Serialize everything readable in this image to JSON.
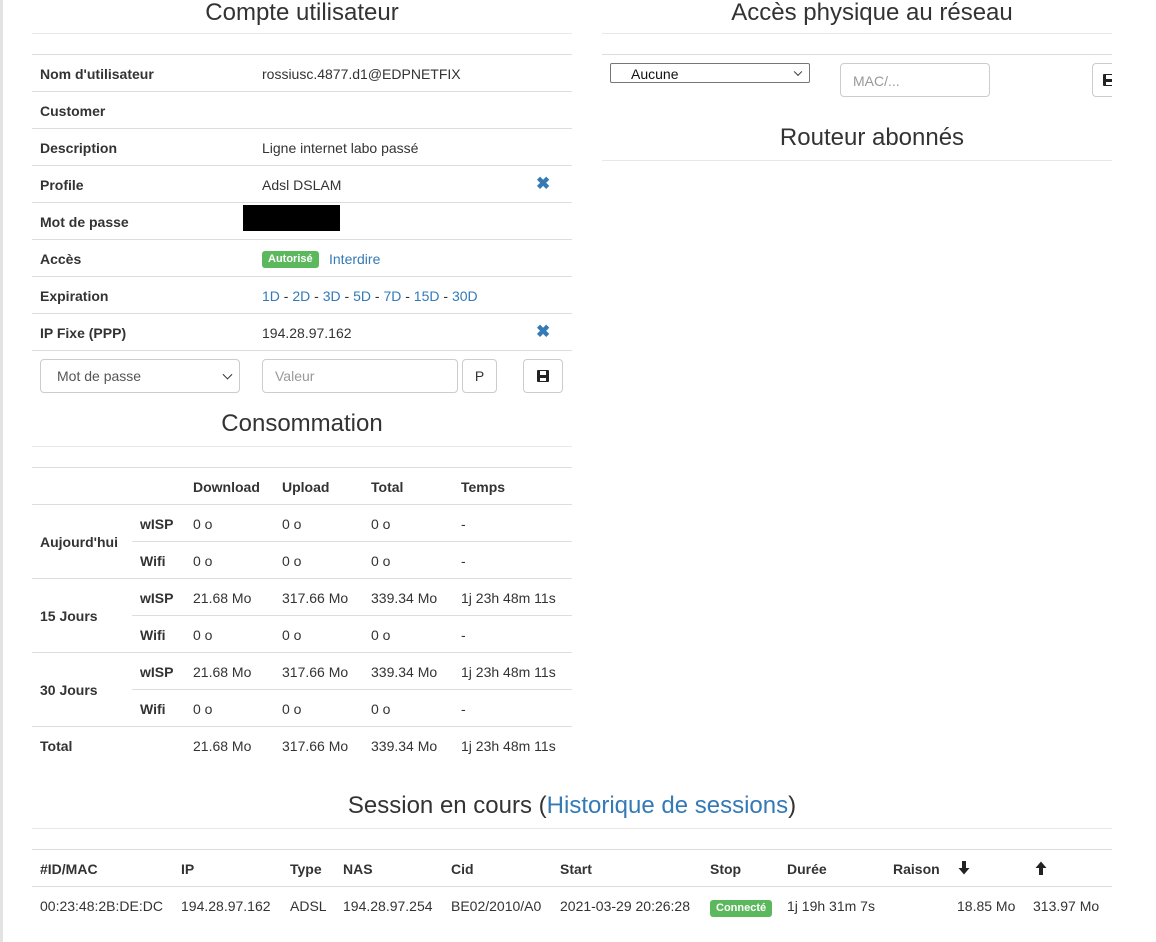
{
  "account": {
    "title": "Compte utilisateur",
    "rows": [
      {
        "label": "Nom d'utilisateur",
        "value": "rossiusc.4877.d1@EDPNETFIX"
      },
      {
        "label": "Customer",
        "value": ""
      },
      {
        "label": "Description",
        "value": "Ligne internet labo passé"
      },
      {
        "label": "Profile",
        "value": "Adsl DSLAM"
      },
      {
        "label": "Mot de passe",
        "value": ""
      },
      {
        "label": "Accès",
        "status_badge": "Autorisé",
        "action_link": "Interdire"
      },
      {
        "label": "Expiration",
        "options": [
          "1D",
          "2D",
          "3D",
          "5D",
          "7D",
          "15D",
          "30D"
        ],
        "separator": " - "
      },
      {
        "label": "IP Fixe (PPP)",
        "value": "194.28.97.162"
      }
    ],
    "form": {
      "select_value": "Mot de passe",
      "input_placeholder": "Valeur",
      "p_button": "P"
    }
  },
  "network": {
    "title": "Accès physique au réseau",
    "select_value": "Aucune",
    "mac_placeholder": "MAC/..."
  },
  "router": {
    "title": "Routeur abonnés"
  },
  "consumption": {
    "title": "Consommation",
    "headers": [
      "Download",
      "Upload",
      "Total",
      "Temps"
    ],
    "groups": [
      {
        "period": "Aujourd'hui",
        "rows": [
          {
            "type": "wISP",
            "download": "0 o",
            "upload": "0 o",
            "total": "0 o",
            "time": "-"
          },
          {
            "type": "Wifi",
            "download": "0 o",
            "upload": "0 o",
            "total": "0 o",
            "time": "-"
          }
        ]
      },
      {
        "period": "15 Jours",
        "rows": [
          {
            "type": "wISP",
            "download": "21.68 Mo",
            "upload": "317.66 Mo",
            "total": "339.34 Mo",
            "time": "1j 23h 48m 11s"
          },
          {
            "type": "Wifi",
            "download": "0 o",
            "upload": "0 o",
            "total": "0 o",
            "time": "-"
          }
        ]
      },
      {
        "period": "30 Jours",
        "rows": [
          {
            "type": "wISP",
            "download": "21.68 Mo",
            "upload": "317.66 Mo",
            "total": "339.34 Mo",
            "time": "1j 23h 48m 11s"
          },
          {
            "type": "Wifi",
            "download": "0 o",
            "upload": "0 o",
            "total": "0 o",
            "time": "-"
          }
        ]
      }
    ],
    "total": {
      "label": "Total",
      "download": "21.68 Mo",
      "upload": "317.66 Mo",
      "total": "339.34 Mo",
      "time": "1j 23h 48m 11s"
    }
  },
  "session": {
    "title_prefix": "Session en cours (",
    "history_link": "Historique de sessions",
    "title_suffix": ")",
    "headers": {
      "id": "#ID/MAC",
      "ip": "IP",
      "type": "Type",
      "nas": "NAS",
      "cid": "Cid",
      "start": "Start",
      "stop": "Stop",
      "duration": "Durée",
      "reason": "Raison"
    },
    "row": {
      "id": "00:23:48:2B:DE:DC",
      "ip": "194.28.97.162",
      "type": "ADSL",
      "nas": "194.28.97.254",
      "cid": "BE02/2010/A0",
      "start": "2021-03-29 20:26:28",
      "stop_badge": "Connecté",
      "duration": "1j 19h 31m 7s",
      "reason": "",
      "down": "18.85 Mo",
      "up": "313.97 Mo"
    }
  },
  "colors": {
    "link": "#337ab7",
    "success": "#5cb85c",
    "text": "#333333",
    "border": "#dddddd"
  }
}
